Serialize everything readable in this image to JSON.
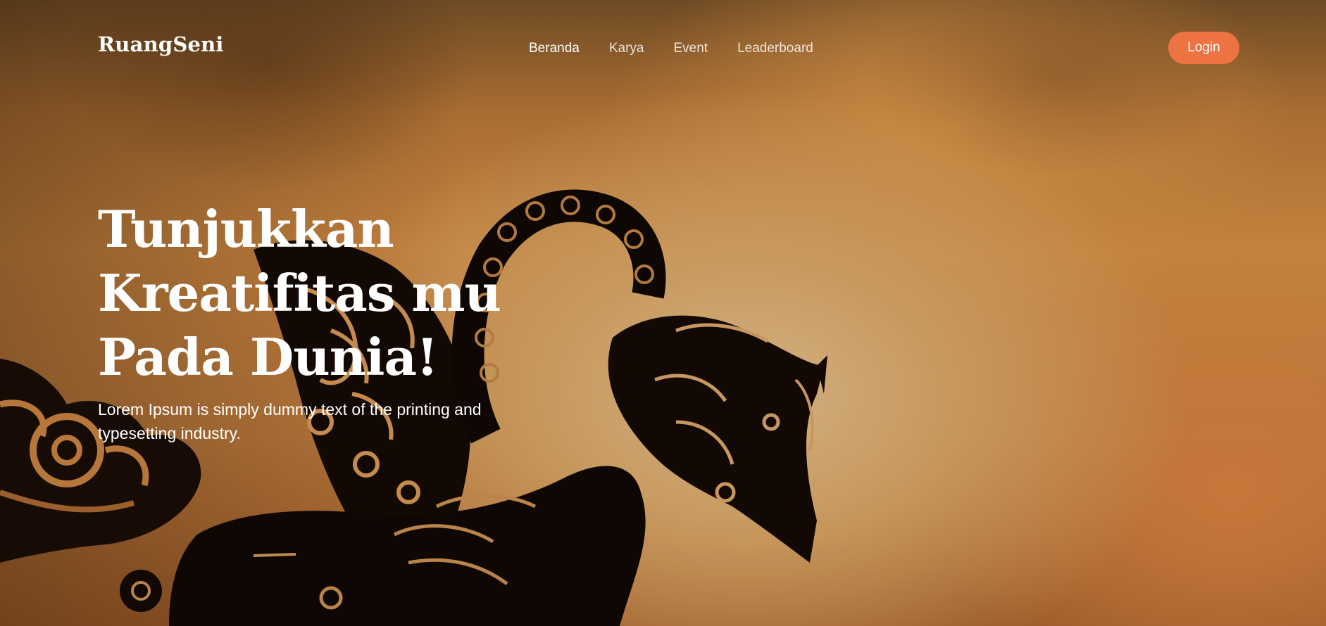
{
  "brand": {
    "name": "RuangSeni"
  },
  "nav": {
    "items": [
      {
        "label": "Beranda",
        "active": true
      },
      {
        "label": "Karya",
        "active": false
      },
      {
        "label": "Event",
        "active": false
      },
      {
        "label": "Leaderboard",
        "active": false
      }
    ],
    "login_label": "Login"
  },
  "hero": {
    "title_lines": [
      "Tunjukkan",
      "Kreatifitas mu",
      "Pada Dunia!"
    ],
    "description": "Lorem Ipsum is simply dummy text of the printing and typesetting industry."
  },
  "theme": {
    "accent": "#ee7342",
    "text": "#ffffff"
  },
  "background": {
    "image": "wayang-puppet-silhouette"
  }
}
